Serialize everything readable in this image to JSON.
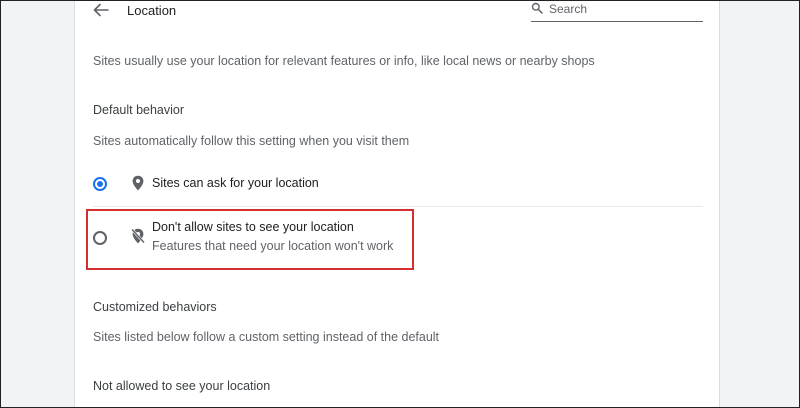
{
  "header": {
    "title": "Location",
    "back_icon": "arrow-back-icon",
    "search": {
      "placeholder": "Search",
      "value": "",
      "icon": "search-icon"
    }
  },
  "intro_text": "Sites usually use your location for relevant features or info, like local news or nearby shops",
  "default_behavior": {
    "heading": "Default behavior",
    "description": "Sites automatically follow this setting when you visit them",
    "options": [
      {
        "label": "Sites can ask for your location",
        "sublabel": "",
        "selected": true,
        "icon": "location-pin-icon"
      },
      {
        "label": "Don't allow sites to see your location",
        "sublabel": "Features that need your location won't work",
        "selected": false,
        "icon": "location-off-icon"
      }
    ]
  },
  "customized_behaviors": {
    "heading": "Customized behaviors",
    "description": "Sites listed below follow a custom setting instead of the default",
    "not_allowed_heading": "Not allowed to see your location"
  },
  "colors": {
    "accent": "#1a73e8",
    "highlight": "#d32f2f",
    "text_primary": "#202124",
    "text_secondary": "#5f6368",
    "background": "#f1f3f4"
  }
}
